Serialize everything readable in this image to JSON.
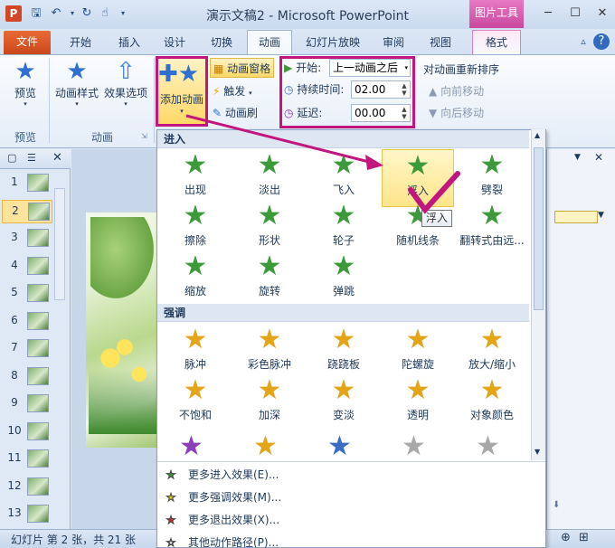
{
  "window": {
    "title": "演示文稿2 - Microsoft PowerPoint",
    "context_tool": "图片工具",
    "app_icon": "P"
  },
  "tabs": {
    "file": "文件",
    "items": [
      "开始",
      "插入",
      "设计",
      "切换",
      "动画",
      "幻灯片放映",
      "审阅",
      "视图"
    ],
    "format": "格式"
  },
  "ribbon": {
    "preview_label": "预览",
    "preview_group": "预览",
    "anim_style_label": "动画样式",
    "effect_options_label": "效果选项",
    "anim_group": "动画",
    "add_anim_label": "添加动画",
    "anim_pane_label": "动画窗格",
    "trigger_label": "触发",
    "anim_painter_label": "动画刷",
    "start_label": "开始:",
    "start_value": "上一动画之后",
    "duration_label": "持续时间:",
    "duration_value": "02.00",
    "delay_label": "延迟:",
    "delay_value": "00.00",
    "reorder_title": "对动画重新排序",
    "move_earlier": "向前移动",
    "move_later": "向后移动"
  },
  "thumbnails": [
    "1",
    "2",
    "3",
    "4",
    "5",
    "6",
    "7",
    "8",
    "9",
    "10",
    "11",
    "12",
    "13"
  ],
  "gallery": {
    "entrance_header": "进入",
    "entrance": [
      "出现",
      "淡出",
      "飞入",
      "浮入",
      "劈裂",
      "擦除",
      "形状",
      "轮子",
      "随机线条",
      "翻转式由远...",
      "缩放",
      "旋转",
      "弹跳"
    ],
    "emphasis_header": "强调",
    "emphasis": [
      "脉冲",
      "彩色脉冲",
      "跷跷板",
      "陀螺旋",
      "放大/缩小",
      "不饱和",
      "加深",
      "变淡",
      "透明",
      "对象颜色"
    ],
    "tooltip": "浮入",
    "more": [
      "更多进入效果(E)...",
      "更多强调效果(M)...",
      "更多退出效果(X)...",
      "其他动作路径(P)..."
    ]
  },
  "status": {
    "slide_info": "幻灯片 第 2 张，共 21 张"
  },
  "colors": {
    "highlight_box": "#c2157e",
    "file_tab": "#d24726",
    "context_tab": "#c9489f"
  }
}
